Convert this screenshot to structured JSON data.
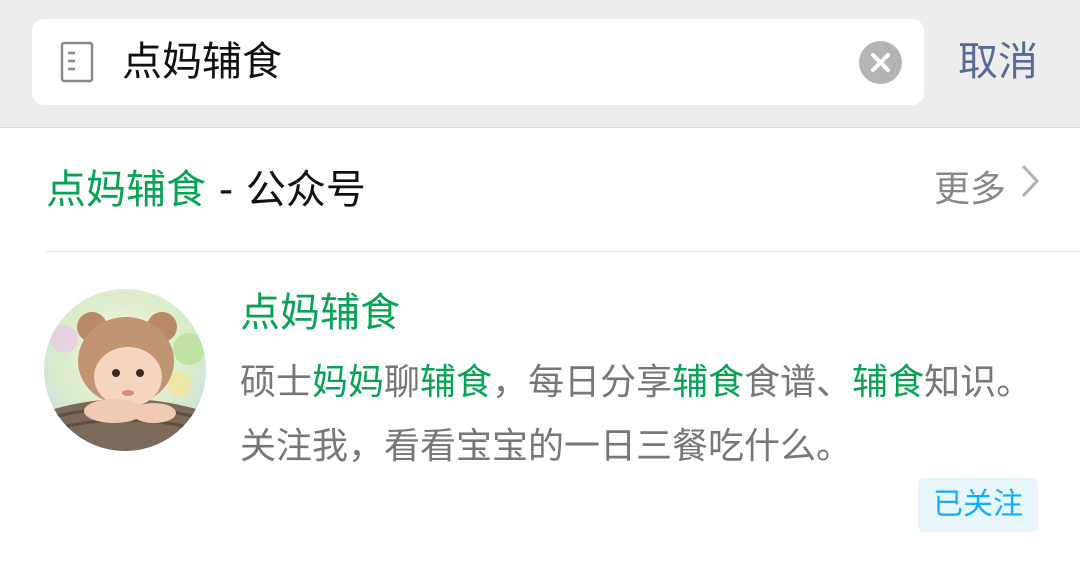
{
  "search": {
    "query": "点妈辅食",
    "cancel_label": "取消",
    "icon": "document-icon",
    "clear_icon": "clear-icon"
  },
  "section": {
    "title_highlight": "点妈辅食",
    "title_rest": " - 公众号",
    "more_label": "更多"
  },
  "result": {
    "name": "点妈辅食",
    "desc_segments": [
      {
        "text": "硕士",
        "hl": false
      },
      {
        "text": "妈妈",
        "hl": true
      },
      {
        "text": "聊",
        "hl": false
      },
      {
        "text": "辅食",
        "hl": true
      },
      {
        "text": "，每日分享",
        "hl": false
      },
      {
        "text": "辅食",
        "hl": true
      },
      {
        "text": "食谱、",
        "hl": false
      },
      {
        "text": "辅食",
        "hl": true
      },
      {
        "text": "知识。关注我，看看宝宝的一日三餐吃什么。",
        "hl": false
      }
    ],
    "status_badge": "已关注"
  },
  "colors": {
    "highlight": "#07a254",
    "link_blue": "#576b95",
    "badge_text": "#10aeff"
  }
}
